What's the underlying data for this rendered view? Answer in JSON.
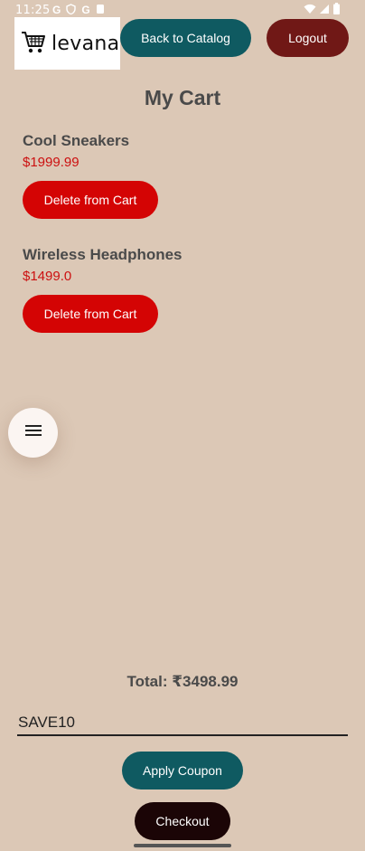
{
  "status_bar": {
    "time": "11:25",
    "left_icons": [
      "G",
      "shield-icon",
      "G",
      "notification-icon"
    ],
    "right_icons": [
      "wifi-icon",
      "signal-icon",
      "battery-icon"
    ]
  },
  "header": {
    "logo_text": "levana",
    "back_label": "Back to Catalog",
    "logout_label": "Logout"
  },
  "page": {
    "title": "My Cart"
  },
  "cart": {
    "items": [
      {
        "name": "Cool Sneakers",
        "price": "$1999.99",
        "delete_label": "Delete from Cart"
      },
      {
        "name": "Wireless Headphones",
        "price": "$1499.0",
        "delete_label": "Delete from Cart"
      }
    ]
  },
  "summary": {
    "total": "Total: ₹3498.99",
    "coupon_value": "SAVE10",
    "apply_label": "Apply Coupon",
    "checkout_label": "Checkout"
  },
  "colors": {
    "background": "#dcc8b6",
    "back_button": "#0f5a61",
    "logout_button": "#701816",
    "delete_button": "#d40404",
    "price_text": "#cc1010",
    "checkout_button": "#1b0506"
  }
}
